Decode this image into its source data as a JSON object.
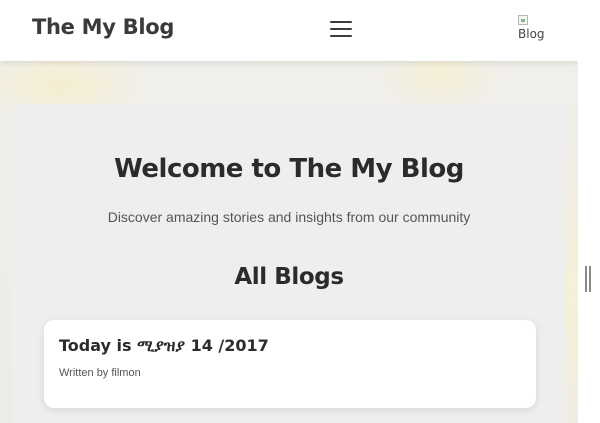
{
  "navbar": {
    "brand": "The My Blog",
    "menu_icon": "hamburger-menu-icon",
    "avatar_alt": "Blog"
  },
  "hero": {
    "title": "Welcome to The My Blog",
    "subtitle": "Discover amazing stories and insights from our community"
  },
  "blogs": {
    "heading": "All Blogs",
    "items": [
      {
        "title": "Today is ሚያዝያ 14 /2017",
        "author": "Written by filmon"
      }
    ]
  },
  "colors": {
    "navbar_bg": "#ffffff",
    "text_dark": "#2b2b2b",
    "card_bg": "#ffffff"
  }
}
